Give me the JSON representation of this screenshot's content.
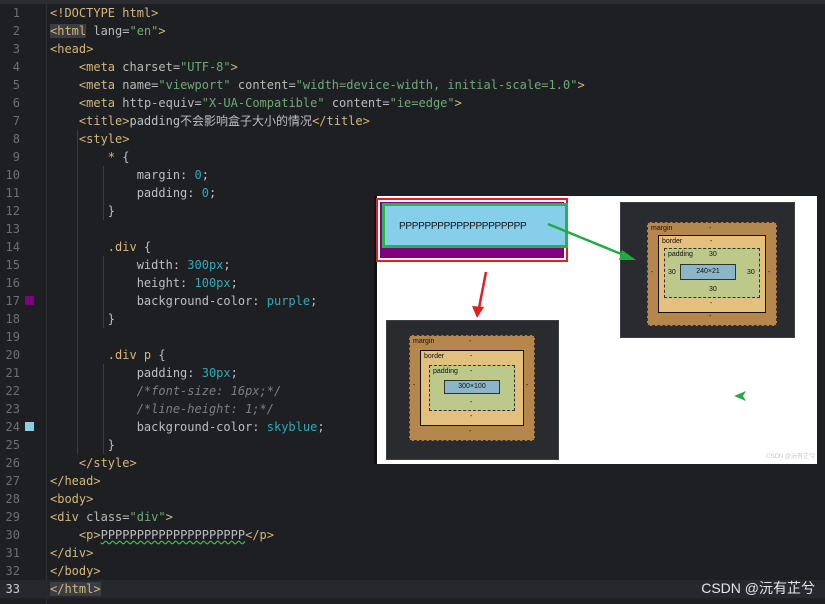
{
  "editor": {
    "swatches": {
      "purple": "#800080",
      "skyblue": "#87ceeb"
    },
    "current_line": "33"
  },
  "overlay": {
    "demo_text": "PPPPPPPPPPPPPPPPPPPP",
    "box_model_large": {
      "margin_label": "margin",
      "margin_value": "-",
      "border_label": "border",
      "border_value": "-",
      "padding_label": "padding",
      "padding_value": "30",
      "padding_left": "30",
      "padding_right": "30",
      "padding_bottom": "30",
      "content_size": "240×21",
      "side_value": "-"
    },
    "box_model_small": {
      "margin_label": "margin",
      "margin_value": "-",
      "border_label": "border",
      "border_value": "-",
      "padding_label": "padding",
      "padding_value": "-",
      "content_size": "300×100",
      "side_value": "-"
    },
    "watermark": "CSDN @沅有芷兮",
    "arrow_colors": {
      "green": "#22aa44",
      "red": "#e02020"
    }
  },
  "footer": {
    "watermark": "CSDN @沅有芷兮"
  }
}
